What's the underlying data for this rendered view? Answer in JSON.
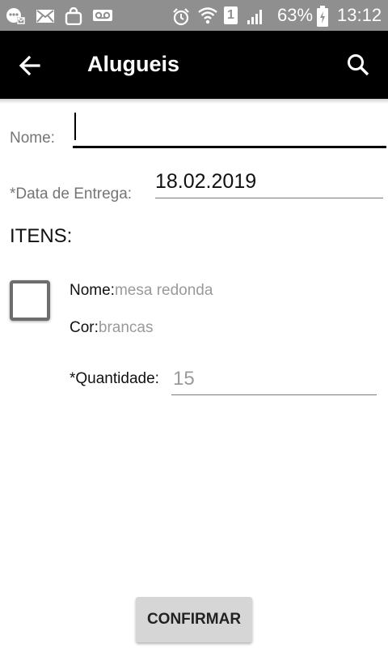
{
  "status_bar": {
    "icons": [
      "notification-icon",
      "mail-icon",
      "shopping-bag-icon",
      "voicemail-icon",
      "alarm-icon",
      "wifi-icon",
      "sim-icon",
      "signal-icon",
      "battery-charging-icon"
    ],
    "sim_number": "1",
    "battery": "63%",
    "time": "13:12"
  },
  "app_bar": {
    "title": "Alugueis",
    "back_icon": "arrow-back-icon",
    "search_icon": "search-icon"
  },
  "form": {
    "nome_label": "Nome:",
    "nome_value": "",
    "data_label": "*Data de Entrega:",
    "data_value": "18.02.2019"
  },
  "itens": {
    "title": "ITENS:",
    "items": [
      {
        "checked": false,
        "nome_label": "Nome:",
        "nome_value": "mesa redonda",
        "cor_label": "Cor:",
        "cor_value": "brancas",
        "quantidade_label": "*Quantidade:",
        "quantidade_value": "15"
      }
    ]
  },
  "confirm_label": "CONFIRMAR"
}
